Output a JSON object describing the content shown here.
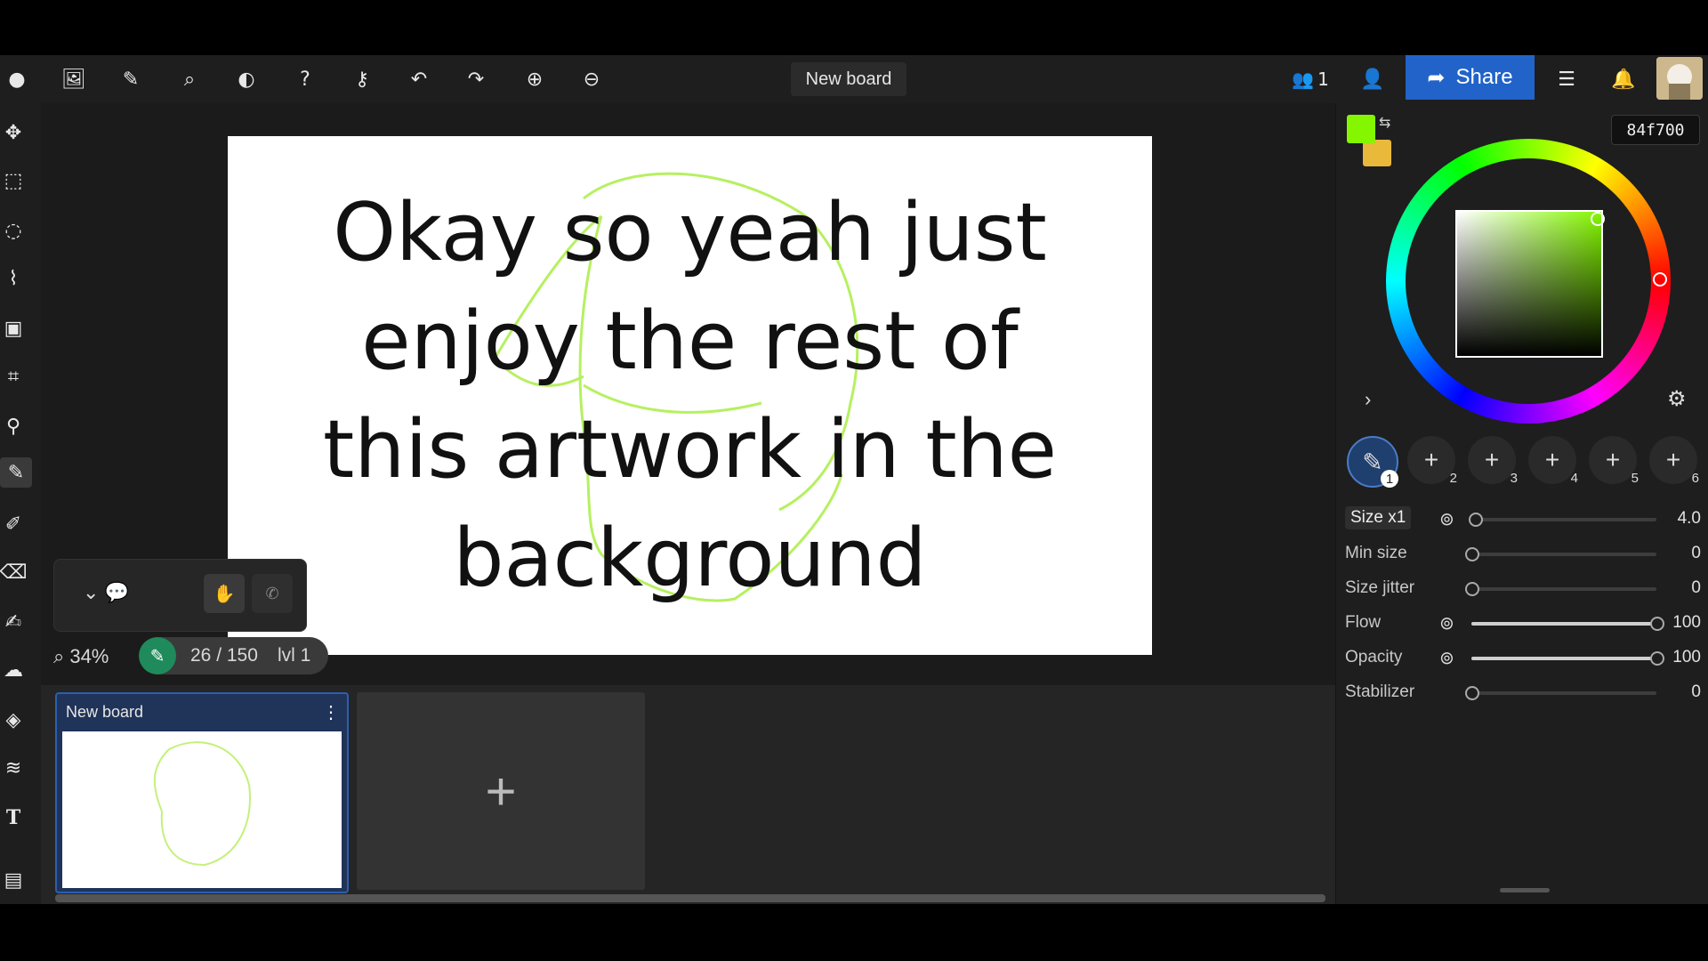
{
  "toolbar": {
    "board_title": "New board",
    "users_count": "1",
    "share_label": "Share"
  },
  "canvas": {
    "overlay_text_lines": [
      "Okay so yeah just",
      "enjoy the rest of",
      "this artwork in the",
      "background"
    ],
    "zoom": "34%",
    "layer_status": "26 / 150",
    "layer_level": "lvl 1"
  },
  "boards": {
    "thumb_title": "New board",
    "add_label": "+"
  },
  "color": {
    "hex": "84f700",
    "primary": "#84f700",
    "secondary": "#e8b93a"
  },
  "brushes": {
    "slots": [
      {
        "num": "1",
        "label": "✎"
      },
      {
        "num": "2",
        "label": "+"
      },
      {
        "num": "3",
        "label": "+"
      },
      {
        "num": "4",
        "label": "+"
      },
      {
        "num": "5",
        "label": "+"
      },
      {
        "num": "6",
        "label": "+"
      }
    ]
  },
  "sliders": {
    "size": {
      "label": "Size x1",
      "value": "4.0",
      "fraction": 0.02
    },
    "min_size": {
      "label": "Min size",
      "value": "0",
      "fraction": 0.0
    },
    "size_jitter": {
      "label": "Size jitter",
      "value": "0",
      "fraction": 0.0
    },
    "flow": {
      "label": "Flow",
      "value": "100",
      "fraction": 1.0
    },
    "opacity": {
      "label": "Opacity",
      "value": "100",
      "fraction": 1.0
    },
    "stabilizer": {
      "label": "Stabilizer",
      "value": "0",
      "fraction": 0.0
    }
  }
}
